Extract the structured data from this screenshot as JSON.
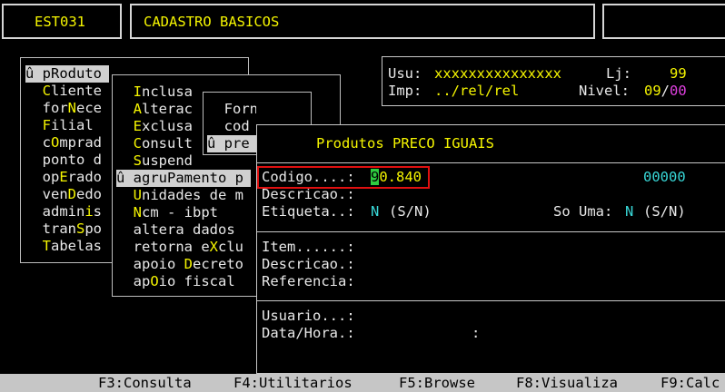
{
  "header": {
    "code": "EST031",
    "title": "CADASTRO BASICOS"
  },
  "user_box": {
    "usu_label": "Usu:",
    "usu_value": "xxxxxxxxxxxxxxx",
    "lj_label": "Lj:",
    "lj_value": "99",
    "imp_label": "Imp:",
    "imp_value": "../rel/rel",
    "nivel_label": "Nivel:",
    "nivel_value_a": "09",
    "nivel_sep": "/",
    "nivel_value_b": "00"
  },
  "menu1": {
    "items": [
      {
        "pre": "û ",
        "hot": "p",
        "rest": "Roduto",
        "selected": true
      },
      {
        "pre": "  ",
        "hot": "C",
        "rest": "liente"
      },
      {
        "pre": "  for",
        "hot": "N",
        "rest": "ece"
      },
      {
        "pre": "  ",
        "hot": "F",
        "rest": "ilial"
      },
      {
        "pre": "  c",
        "hot": "O",
        "rest": "mprad"
      },
      {
        "pre": "  ponto d",
        "hot": "",
        "rest": ""
      },
      {
        "pre": "  op",
        "hot": "E",
        "rest": "rado"
      },
      {
        "pre": "  ven",
        "hot": "D",
        "rest": "edo"
      },
      {
        "pre": "  admin",
        "hot": "i",
        "rest": "s"
      },
      {
        "pre": "  tran",
        "hot": "S",
        "rest": "po"
      },
      {
        "pre": "  ",
        "hot": "T",
        "rest": "abelas"
      }
    ]
  },
  "menu2": {
    "items": [
      {
        "pre": "  ",
        "hot": "I",
        "rest": "nclusa"
      },
      {
        "pre": "  ",
        "hot": "A",
        "rest": "lterac"
      },
      {
        "pre": "  ",
        "hot": "E",
        "rest": "xclusa"
      },
      {
        "pre": "  ",
        "hot": "C",
        "rest": "onsult"
      },
      {
        "pre": "  ",
        "hot": "S",
        "rest": "uspend"
      },
      {
        "pre": "û agru",
        "hot": "P",
        "rest": "amento p",
        "selected": true
      },
      {
        "pre": "  ",
        "hot": "U",
        "rest": "nidades de m"
      },
      {
        "pre": "  ",
        "hot": "N",
        "rest": "cm - ibpt"
      },
      {
        "pre": "  altera dados",
        "hot": "",
        "rest": ""
      },
      {
        "pre": "  retorna e",
        "hot": "X",
        "rest": "clu"
      },
      {
        "pre": "  apoio ",
        "hot": "D",
        "rest": "ecreto"
      },
      {
        "pre": "  ap",
        "hot": "O",
        "rest": "io fiscal"
      }
    ]
  },
  "menu3": {
    "items": [
      {
        "text": "  Fornece"
      },
      {
        "text": "  cod"
      },
      {
        "text": "û pre",
        "selected": true
      }
    ]
  },
  "dialog": {
    "title": "Produtos PRECO IGUAIS",
    "codigo_label": "Codigo....:",
    "codigo_cursor": "9",
    "codigo_rest": "0.840",
    "codigo_right": "00000",
    "descricao_label": "Descricao.:",
    "etiqueta_label": "Etiqueta..:",
    "etiqueta_value": "N",
    "etiqueta_hint": "(S/N)",
    "so_uma_label": "So Uma:",
    "so_uma_value": "N",
    "so_uma_hint": "(S/N)",
    "item_label": "Item......:",
    "descricao2_label": "Descricao.:",
    "referencia_label": "Referencia:",
    "usuario_label": "Usuario...:",
    "datahora_label": "Data/Hora.:",
    "datahora_colon": ":"
  },
  "fkeys": [
    "F3:Consulta",
    "F4:Utilitarios",
    "F5:Browse",
    "F8:Visualiza",
    "F9:Calc"
  ]
}
